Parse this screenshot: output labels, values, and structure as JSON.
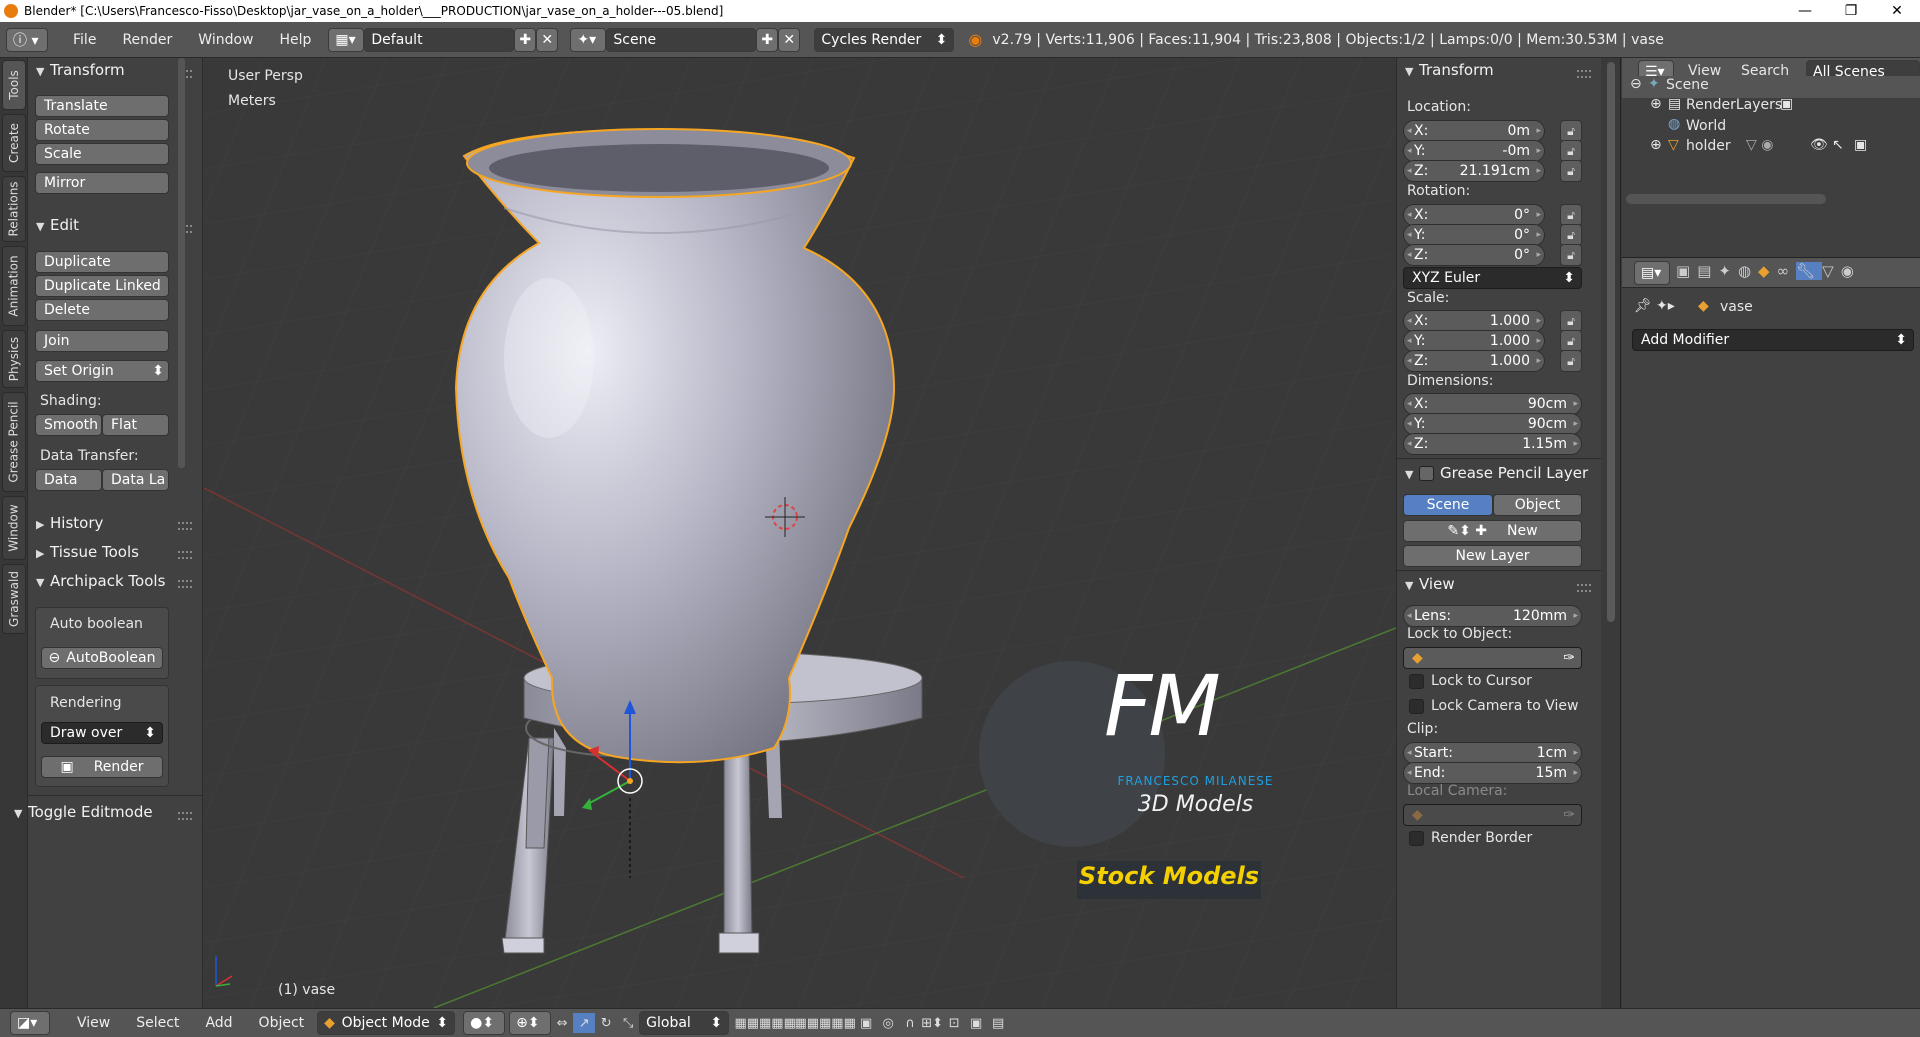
{
  "window": {
    "title": "Blender* [C:\\Users\\Francesco-Fisso\\Desktop\\jar_vase_on_a_holder\\___PRODUCTION\\jar_vase_on_a_holder---05.blend]",
    "min": "—",
    "max": "❐",
    "close": "✕"
  },
  "header": {
    "menus": [
      "File",
      "Render",
      "Window",
      "Help"
    ],
    "layout": "Default",
    "scene": "Scene",
    "engine": "Cycles Render",
    "stats": "v2.79 | Verts:11,906 | Faces:11,904 | Tris:23,808 | Objects:1/2 | Lamps:0/0 | Mem:30.53M | vase"
  },
  "tabs": [
    "Tools",
    "Create",
    "Relations",
    "Animation",
    "Physics",
    "Grease Pencil",
    "Window",
    "Graswald"
  ],
  "toolshelf": {
    "transform_title": "Transform",
    "translate": "Translate",
    "rotate": "Rotate",
    "scale": "Scale",
    "mirror": "Mirror",
    "edit_title": "Edit",
    "duplicate": "Duplicate",
    "duplicate_linked": "Duplicate Linked",
    "delete": "Delete",
    "join": "Join",
    "set_origin": "Set Origin",
    "shading_label": "Shading:",
    "smooth": "Smooth",
    "flat": "Flat",
    "data_transfer_label": "Data Transfer:",
    "data": "Data",
    "data_la": "Data La",
    "history": "History",
    "tissue": "Tissue Tools",
    "archipack": "Archipack Tools",
    "auto_boolean_label": "Auto boolean",
    "autoboolean_btn": "AutoBoolean",
    "rendering_label": "Rendering",
    "draw_over": "Draw over",
    "render_btn": "Render",
    "toggle_editmode": "Toggle Editmode"
  },
  "viewport": {
    "view_name": "User Persp",
    "units": "Meters",
    "object_label": "(1) vase",
    "watermark": {
      "letters": "FM",
      "name": "FRANCESCO MILANESE",
      "sub": "3D Models",
      "stock": "Stock Models"
    }
  },
  "npanel": {
    "transform_title": "Transform",
    "location_label": "Location:",
    "loc": [
      {
        "axis": "X:",
        "value": "0m"
      },
      {
        "axis": "Y:",
        "value": "-0m"
      },
      {
        "axis": "Z:",
        "value": "21.191cm"
      }
    ],
    "rotation_label": "Rotation:",
    "rot": [
      {
        "axis": "X:",
        "value": "0°"
      },
      {
        "axis": "Y:",
        "value": "0°"
      },
      {
        "axis": "Z:",
        "value": "0°"
      }
    ],
    "rot_mode": "XYZ Euler",
    "scale_label": "Scale:",
    "scale": [
      {
        "axis": "X:",
        "value": "1.000"
      },
      {
        "axis": "Y:",
        "value": "1.000"
      },
      {
        "axis": "Z:",
        "value": "1.000"
      }
    ],
    "dimensions_label": "Dimensions:",
    "dim": [
      {
        "axis": "X:",
        "value": "90cm"
      },
      {
        "axis": "Y:",
        "value": "90cm"
      },
      {
        "axis": "Z:",
        "value": "1.15m"
      }
    ],
    "gp_title": "Grease Pencil Layer",
    "gp_scene": "Scene",
    "gp_object": "Object",
    "gp_new": "New",
    "gp_new_layer": "New Layer",
    "view_title": "View",
    "lens_label": "Lens:",
    "lens_value": "120mm",
    "lock_obj_label": "Lock to Object:",
    "lock_cursor": "Lock to Cursor",
    "lock_camera": "Lock Camera to View",
    "clip_label": "Clip:",
    "clip_start_label": "Start:",
    "clip_start": "1cm",
    "clip_end_label": "End:",
    "clip_end": "15m",
    "local_camera": "Local Camera:",
    "render_border": "Render Border"
  },
  "outliner": {
    "view": "View",
    "search": "Search",
    "all_scenes": "All Scenes",
    "items": [
      "Scene",
      "RenderLayers",
      "World",
      "holder"
    ]
  },
  "properties": {
    "object": "vase",
    "add_modifier": "Add Modifier"
  },
  "bottombar": {
    "view": "View",
    "select": "Select",
    "add": "Add",
    "object": "Object",
    "mode": "Object Mode",
    "orientation": "Global"
  },
  "colors": {
    "accent": "#5680c2",
    "selected_outline": "#f5a623",
    "vase": "#c9c9d6",
    "grid": "#444444",
    "bg": "#393939"
  }
}
